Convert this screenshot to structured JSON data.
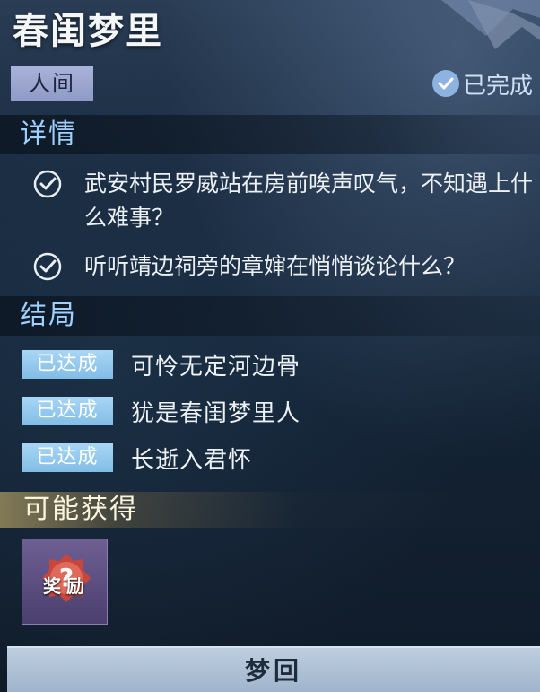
{
  "quest": {
    "title": "春闺梦里",
    "realm": "人间",
    "status": "已完成"
  },
  "details": {
    "heading": "详情",
    "items": [
      {
        "text": "武安村民罗威站在房前唉声叹气，不知遇上什么难事？"
      },
      {
        "text": "听听靖边祠旁的章婶在悄悄谈论什么？"
      }
    ]
  },
  "endings": {
    "heading": "结局",
    "badge": "已达成",
    "items": [
      {
        "text": "可怜无定河边骨"
      },
      {
        "text": "犹是春闺梦里人"
      },
      {
        "text": "长逝入君怀"
      }
    ]
  },
  "rewards": {
    "heading": "可能获得",
    "items": [
      {
        "label": "奖励",
        "icon": "mystery-reward-icon"
      }
    ]
  },
  "action": {
    "label": "梦回"
  },
  "colors": {
    "accent": "#9fd0ff",
    "realm_badge": "#a9b3d9",
    "achieved_badge": "#a8d6f5",
    "reward_heading_glow": "#dcbe6e",
    "button": "#bfcfe0"
  }
}
